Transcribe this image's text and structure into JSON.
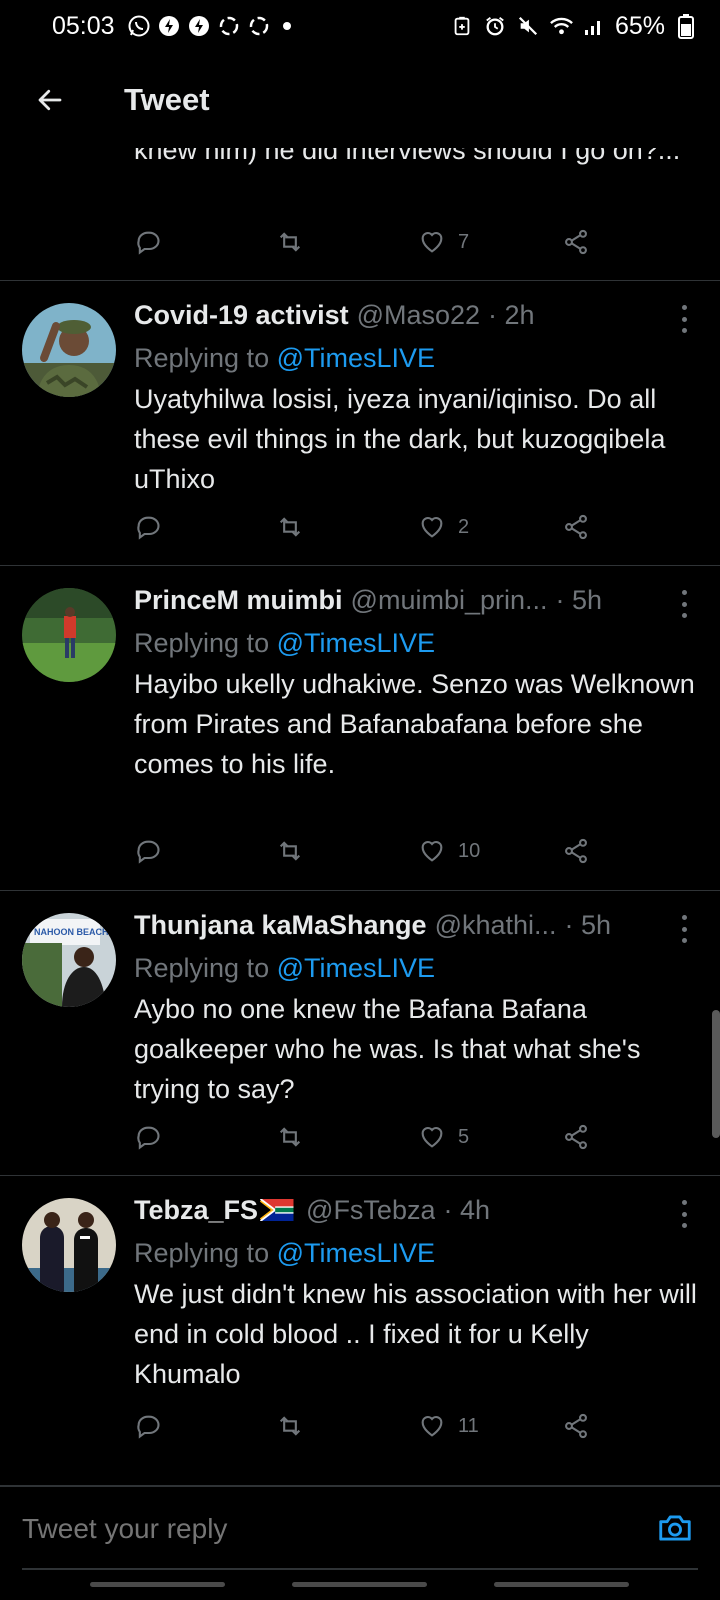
{
  "status_bar": {
    "time": "05:03",
    "battery": "65%",
    "icons": [
      "whatsapp-icon",
      "notification-icon",
      "notification-icon",
      "sync-icon",
      "sync-icon",
      "dot-icon",
      "battery-saver-icon",
      "alarm-icon",
      "mute-icon",
      "wifi-icon",
      "signal-icon",
      "battery-icon"
    ]
  },
  "header": {
    "title": "Tweet",
    "back_icon": "arrow-left-icon"
  },
  "partial_tweet": {
    "text": "knew him) he did interviews should I go on?...",
    "likes": "7"
  },
  "tweets": [
    {
      "name": "Covid-19 activist",
      "handle": "@Maso22",
      "time": "· 2h",
      "replying_label": "Replying to ",
      "mention": "@TimesLIVE",
      "text": "Uyatyhilwa losisi, iyeza inyani/iqiniso. Do all these evil things in the dark, but kuzogqibela uThixo",
      "likes": "2"
    },
    {
      "name": "PrinceM muimbi",
      "handle": "@muimbi_prin...",
      "time": "· 5h",
      "replying_label": "Replying to ",
      "mention": "@TimesLIVE",
      "text": "Hayibo ukelly udhakiwe. Senzo was Welknown from Pirates and Bafanabafana before she comes to his life.",
      "likes": "10"
    },
    {
      "name": "Thunjana kaMaShange",
      "handle": "@khathi...",
      "time": "· 5h",
      "replying_label": "Replying to ",
      "mention": "@TimesLIVE",
      "text": "Aybo no one knew the Bafana Bafana goalkeeper who he was.  Is that what she's trying to say?",
      "avatar_sign": "NAHOON BEACH",
      "likes": "5"
    },
    {
      "name": "Tebza_FS",
      "handle": "@FsTebza",
      "time": "· 4h",
      "replying_label": "Replying to ",
      "mention": "@TimesLIVE",
      "text": "We just didn't knew his association with her will end in cold blood .. I fixed it for u Kelly Khumalo",
      "likes": "11"
    }
  ],
  "reply_bar": {
    "placeholder": "Tweet your reply",
    "camera_icon": "camera-icon"
  },
  "colors": {
    "background": "#000000",
    "accent": "#1d9bf0",
    "muted": "#71767b",
    "text": "#e7e9ea",
    "divider": "#2f3336"
  }
}
